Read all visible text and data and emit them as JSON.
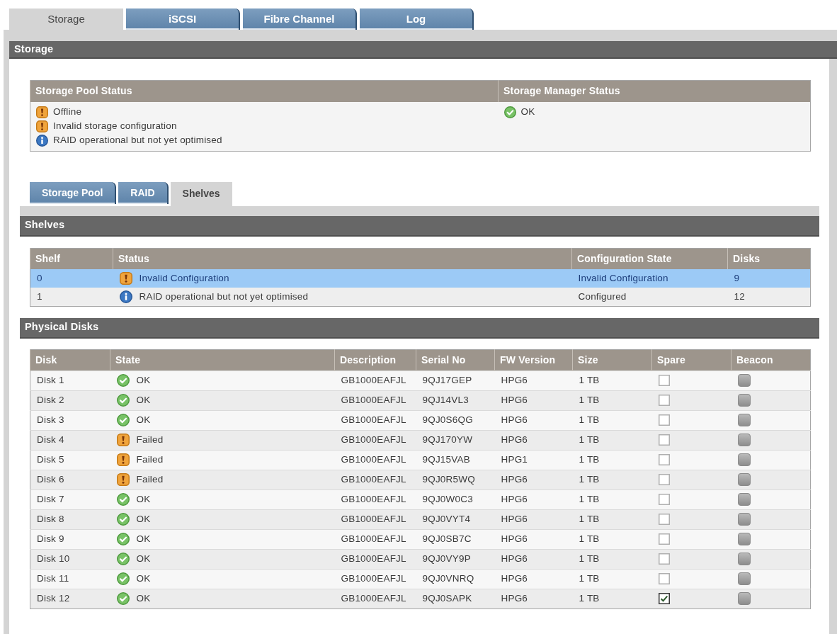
{
  "tabs": [
    {
      "label": "Storage",
      "selected": true
    },
    {
      "label": "iSCSI",
      "selected": false
    },
    {
      "label": "Fibre Channel",
      "selected": false
    },
    {
      "label": "Log",
      "selected": false
    }
  ],
  "storage": {
    "title": "Storage",
    "columns": [
      "Storage Pool Status",
      "Storage Manager Status"
    ],
    "pool_status": [
      {
        "kind": "warning",
        "text": "Offline"
      },
      {
        "kind": "warning",
        "text": "Invalid storage configuration"
      },
      {
        "kind": "info",
        "text": "RAID operational but not yet optimised"
      }
    ],
    "manager_status": [
      {
        "kind": "ok",
        "text": "OK"
      }
    ]
  },
  "sub_tabs": [
    {
      "label": "Storage Pool",
      "selected": false
    },
    {
      "label": "RAID",
      "selected": false
    },
    {
      "label": "Shelves",
      "selected": true
    }
  ],
  "shelves": {
    "title": "Shelves",
    "columns": [
      "Shelf",
      "Status",
      "Configuration State",
      "Disks"
    ],
    "rows": [
      {
        "shelf": "0",
        "kind": "warning",
        "status": "Invalid Configuration",
        "configuration_state": "Invalid Configuration",
        "disks": "9",
        "selected": true
      },
      {
        "shelf": "1",
        "kind": "info",
        "status": "RAID operational but not yet optimised",
        "configuration_state": "Configured",
        "disks": "12",
        "selected": false
      }
    ]
  },
  "physical_disks": {
    "title": "Physical Disks",
    "columns": [
      "Disk",
      "State",
      "Description",
      "Serial No",
      "FW Version",
      "Size",
      "Spare",
      "Beacon"
    ],
    "rows": [
      {
        "disk": "Disk 1",
        "kind": "ok",
        "state": "OK",
        "description": "GB1000EAFJL",
        "serial_no": "9QJ17GEP",
        "fw_version": "HPG6",
        "size": "1 TB",
        "spare": false
      },
      {
        "disk": "Disk 2",
        "kind": "ok",
        "state": "OK",
        "description": "GB1000EAFJL",
        "serial_no": "9QJ14VL3",
        "fw_version": "HPG6",
        "size": "1 TB",
        "spare": false
      },
      {
        "disk": "Disk 3",
        "kind": "ok",
        "state": "OK",
        "description": "GB1000EAFJL",
        "serial_no": "9QJ0S6QG",
        "fw_version": "HPG6",
        "size": "1 TB",
        "spare": false
      },
      {
        "disk": "Disk 4",
        "kind": "warning",
        "state": "Failed",
        "description": "GB1000EAFJL",
        "serial_no": "9QJ170YW",
        "fw_version": "HPG6",
        "size": "1 TB",
        "spare": false
      },
      {
        "disk": "Disk 5",
        "kind": "warning",
        "state": "Failed",
        "description": "GB1000EAFJL",
        "serial_no": "9QJ15VAB",
        "fw_version": "HPG1",
        "size": "1 TB",
        "spare": false
      },
      {
        "disk": "Disk 6",
        "kind": "warning",
        "state": "Failed",
        "description": "GB1000EAFJL",
        "serial_no": "9QJ0R5WQ",
        "fw_version": "HPG6",
        "size": "1 TB",
        "spare": false
      },
      {
        "disk": "Disk 7",
        "kind": "ok",
        "state": "OK",
        "description": "GB1000EAFJL",
        "serial_no": "9QJ0W0C3",
        "fw_version": "HPG6",
        "size": "1 TB",
        "spare": false
      },
      {
        "disk": "Disk 8",
        "kind": "ok",
        "state": "OK",
        "description": "GB1000EAFJL",
        "serial_no": "9QJ0VYT4",
        "fw_version": "HPG6",
        "size": "1 TB",
        "spare": false
      },
      {
        "disk": "Disk 9",
        "kind": "ok",
        "state": "OK",
        "description": "GB1000EAFJL",
        "serial_no": "9QJ0SB7C",
        "fw_version": "HPG6",
        "size": "1 TB",
        "spare": false
      },
      {
        "disk": "Disk 10",
        "kind": "ok",
        "state": "OK",
        "description": "GB1000EAFJL",
        "serial_no": "9QJ0VY9P",
        "fw_version": "HPG6",
        "size": "1 TB",
        "spare": false
      },
      {
        "disk": "Disk 11",
        "kind": "ok",
        "state": "OK",
        "description": "GB1000EAFJL",
        "serial_no": "9QJ0VNRQ",
        "fw_version": "HPG6",
        "size": "1 TB",
        "spare": false
      },
      {
        "disk": "Disk 12",
        "kind": "ok",
        "state": "OK",
        "description": "GB1000EAFJL",
        "serial_no": "9QJ0SAPK",
        "fw_version": "HPG6",
        "size": "1 TB",
        "spare": true
      }
    ]
  }
}
